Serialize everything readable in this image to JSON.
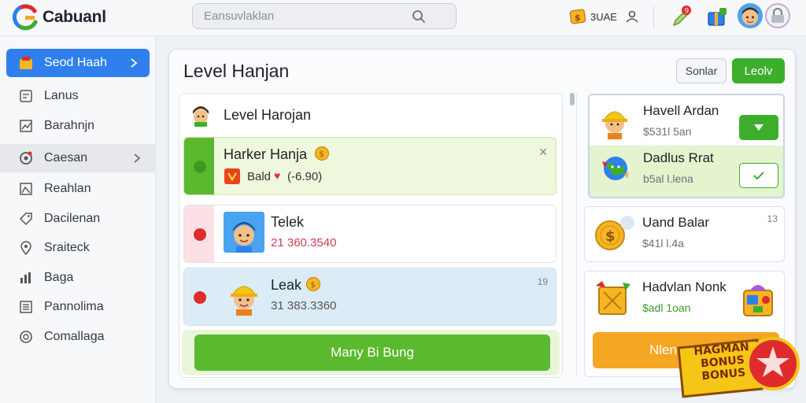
{
  "app": {
    "name": "Cabuanl"
  },
  "search": {
    "placeholder": "Eansuvlaklan"
  },
  "topbar": {
    "coins_label": "3UAE"
  },
  "sidebar": {
    "items": [
      {
        "label": "Seod Haah"
      },
      {
        "label": "Lanus"
      },
      {
        "label": "Barahnjn"
      },
      {
        "label": "Caesan"
      },
      {
        "label": "Reahlan"
      },
      {
        "label": "Dacilenan"
      },
      {
        "label": "Sraiteck"
      },
      {
        "label": "Baga"
      },
      {
        "label": "Pannolima"
      },
      {
        "label": "Comallaga"
      }
    ]
  },
  "main": {
    "title": "Level Hanjan",
    "secondary_button": "Sonlar",
    "primary_button": "Leolv",
    "list_title": "Level Harojan",
    "rows": [
      {
        "name": "Harker Hanja",
        "sub": "Bald",
        "sub_value": "(-6.90)",
        "meta": "✕"
      },
      {
        "name": "Telek",
        "sub": "21 360.3540",
        "meta": ""
      },
      {
        "name": "Leak",
        "sub": "31 383.3360",
        "meta": "19"
      }
    ],
    "cta_label": "Many Bi Bung"
  },
  "right": {
    "cards": [
      {
        "name": "Havell Ardan",
        "sub": "$531l 5an"
      },
      {
        "name": "Dadlus Rrat",
        "sub": "b5al l.lena"
      },
      {
        "name": "Uand Balar",
        "sub": "$41l l.4a",
        "meta": "13"
      },
      {
        "name": "Hadvlan Nonk",
        "sub": "$adl 1oan"
      }
    ],
    "cta_label": "Nlen"
  },
  "badge": {
    "line1": "HAGMAN",
    "line2": "BONUS",
    "line3": "BONUS"
  },
  "colors": {
    "accent": "#2f80ed",
    "green": "#3cae2c",
    "orange": "#f5a623",
    "red": "#e02b2b"
  }
}
